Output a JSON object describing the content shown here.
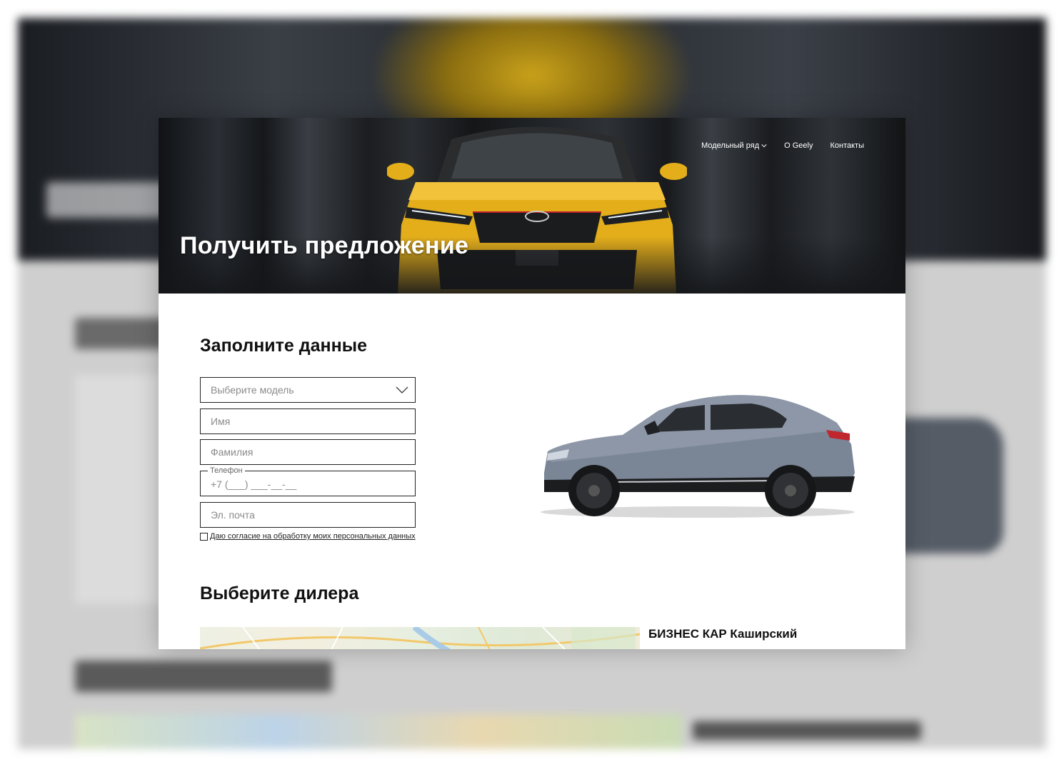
{
  "nav": {
    "items": [
      {
        "label": "Модельный ряд",
        "has_dropdown": true
      },
      {
        "label": "О Geely",
        "has_dropdown": false
      },
      {
        "label": "Контакты",
        "has_dropdown": false
      }
    ]
  },
  "hero": {
    "title": "Получить предложение"
  },
  "form": {
    "title": "Заполните данные",
    "model_select_placeholder": "Выберите модель",
    "first_name_placeholder": "Имя",
    "last_name_placeholder": "Фамилия",
    "phone_label": "Телефон",
    "phone_mask": "+7 (___) ___-__-__",
    "email_placeholder": "Эл. почта",
    "consent_label": "Даю согласие на обработку моих персональных данных"
  },
  "dealer": {
    "title": "Выберите дилера",
    "first_dealer_name": "БИЗНЕС КАР Каширский"
  },
  "icons": {
    "dropdown": "chevron-down-icon",
    "select_dropdown": "chevron-down-icon",
    "checkbox": "checkbox-icon"
  },
  "colors": {
    "accent_yellow": "#e4ae1b",
    "car_side_color": "#7a8596",
    "text_primary": "#111111",
    "border": "#222222"
  }
}
